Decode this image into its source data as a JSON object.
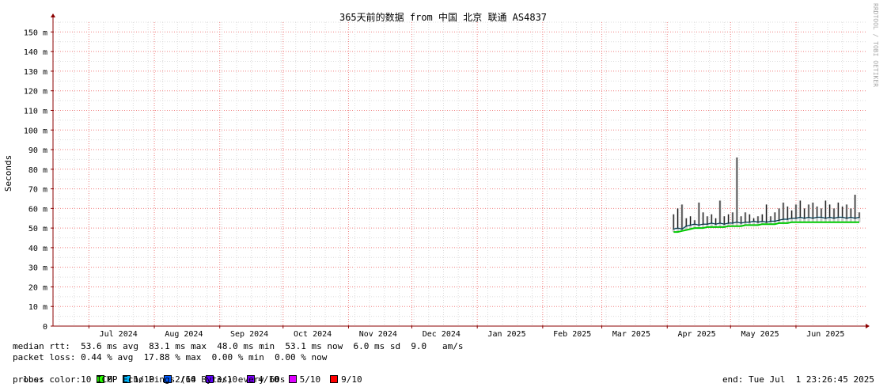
{
  "chart_data": {
    "type": "line",
    "title": "365天前的数据 from 中国 北京 联通 AS4837",
    "xlabel": "",
    "ylabel": "Seconds",
    "ylim": [
      0,
      155
    ],
    "y_ticks": [
      {
        "v": 0,
        "label": "0"
      },
      {
        "v": 10,
        "label": "10 m"
      },
      {
        "v": 20,
        "label": "20 m"
      },
      {
        "v": 30,
        "label": "30 m"
      },
      {
        "v": 40,
        "label": "40 m"
      },
      {
        "v": 50,
        "label": "50 m"
      },
      {
        "v": 60,
        "label": "60 m"
      },
      {
        "v": 70,
        "label": "70 m"
      },
      {
        "v": 80,
        "label": "80 m"
      },
      {
        "v": 90,
        "label": "90 m"
      },
      {
        "v": 100,
        "label": "100 m"
      },
      {
        "v": 110,
        "label": "110 m"
      },
      {
        "v": 120,
        "label": "120 m"
      },
      {
        "v": 130,
        "label": "130 m"
      },
      {
        "v": 140,
        "label": "140 m"
      },
      {
        "v": 150,
        "label": "150 m"
      }
    ],
    "x_range": [
      "2024-06-14",
      "2025-07-04"
    ],
    "x_month_starts": [
      "2024-07-01",
      "2024-08-01",
      "2024-09-01",
      "2024-10-01",
      "2024-11-01",
      "2024-12-01",
      "2025-01-01",
      "2025-02-01",
      "2025-03-01",
      "2025-04-01",
      "2025-05-01",
      "2025-06-01"
    ],
    "x_tick_labels": [
      {
        "date": "2024-07-15",
        "label": "Jul 2024"
      },
      {
        "date": "2024-08-15",
        "label": "Aug 2024"
      },
      {
        "date": "2024-09-15",
        "label": "Sep 2024"
      },
      {
        "date": "2024-10-15",
        "label": "Oct 2024"
      },
      {
        "date": "2024-11-15",
        "label": "Nov 2024"
      },
      {
        "date": "2024-12-15",
        "label": "Dec 2024"
      },
      {
        "date": "2025-01-15",
        "label": "Jan 2025"
      },
      {
        "date": "2025-02-15",
        "label": "Feb 2025"
      },
      {
        "date": "2025-03-15",
        "label": "Mar 2025"
      },
      {
        "date": "2025-04-15",
        "label": "Apr 2025"
      },
      {
        "date": "2025-05-15",
        "label": "May 2025"
      },
      {
        "date": "2025-06-15",
        "label": "Jun 2025"
      }
    ],
    "series": [
      {
        "x": [
          "2025-04-04",
          "2025-04-06",
          "2025-04-08",
          "2025-04-10",
          "2025-04-12",
          "2025-04-14",
          "2025-04-16",
          "2025-04-18",
          "2025-04-20",
          "2025-04-22",
          "2025-04-24",
          "2025-04-26",
          "2025-04-28",
          "2025-04-30",
          "2025-05-02",
          "2025-05-04",
          "2025-05-06",
          "2025-05-08",
          "2025-05-10",
          "2025-05-12",
          "2025-05-14",
          "2025-05-16",
          "2025-05-18",
          "2025-05-20",
          "2025-05-22",
          "2025-05-24",
          "2025-05-26",
          "2025-05-28",
          "2025-05-30",
          "2025-06-01",
          "2025-06-03",
          "2025-06-05",
          "2025-06-07",
          "2025-06-09",
          "2025-06-11",
          "2025-06-13",
          "2025-06-15",
          "2025-06-17",
          "2025-06-19",
          "2025-06-21",
          "2025-06-23",
          "2025-06-25",
          "2025-06-27",
          "2025-06-29",
          "2025-07-01"
        ],
        "median": [
          49.5,
          50.0,
          49.5,
          51.0,
          51.5,
          52.0,
          51.5,
          52.0,
          52.0,
          52.5,
          52.0,
          52.5,
          52.0,
          52.5,
          52.5,
          53.0,
          52.5,
          53.0,
          53.0,
          53.5,
          53.0,
          53.5,
          53.0,
          53.5,
          53.5,
          54.0,
          54.5,
          54.5,
          55.0,
          55.0,
          55.5,
          55.0,
          55.5,
          55.0,
          55.5,
          55.5,
          55.0,
          55.5,
          55.0,
          55.5,
          55.5,
          55.0,
          55.5,
          55.0,
          55.5
        ],
        "max": [
          57,
          60,
          62,
          55,
          56,
          54,
          63,
          58,
          56,
          57,
          55,
          64,
          56,
          57,
          58,
          86,
          56,
          58,
          57,
          55,
          56,
          57,
          62,
          56,
          58,
          60,
          63,
          61,
          59,
          62,
          64,
          60,
          62,
          63,
          61,
          60,
          64,
          62,
          60,
          63,
          61,
          62,
          60,
          67,
          58
        ],
        "min": [
          48.0,
          48.0,
          48.5,
          49.0,
          49.5,
          50.0,
          50.0,
          50.0,
          50.5,
          50.5,
          50.5,
          50.5,
          50.5,
          51.0,
          51.0,
          51.0,
          51.0,
          51.5,
          51.5,
          51.5,
          51.5,
          52.0,
          52.0,
          52.0,
          52.0,
          52.5,
          52.5,
          52.5,
          53.0,
          53.0,
          53.0,
          53.0,
          53.0,
          53.0,
          53.0,
          53.0,
          53.0,
          53.0,
          53.0,
          53.0,
          53.0,
          53.0,
          53.0,
          53.0,
          53.0
        ]
      }
    ],
    "grid": true,
    "colors": {
      "minor_grid": "#dcdcdc",
      "major_grid": "#f08080",
      "axis": "#8b0000",
      "smoke": "#cccccc",
      "median_line": "#1a1a1a",
      "loss_band": "#00c800"
    }
  },
  "stats": {
    "median_rtt": "median rtt:  53.6 ms avg  83.1 ms max  48.0 ms min  53.1 ms now  6.0 ms sd  9.0   am/s",
    "packet_loss": "packet loss: 0.44 % avg  17.88 % max  0.00 % min  0.00 % now",
    "loss_color_label": "loss color:",
    "loss_colors": [
      {
        "label": "0",
        "color": "#26ff00"
      },
      {
        "label": "1/10",
        "color": "#00b8ff"
      },
      {
        "label": "2/10",
        "color": "#0059ff"
      },
      {
        "label": "3/10",
        "color": "#5e00ff"
      },
      {
        "label": "4/10",
        "color": "#7e00ff"
      },
      {
        "label": "5/10",
        "color": "#dd00ff"
      },
      {
        "label": "9/10",
        "color": "#ff0000"
      }
    ],
    "probe": "probe:       10 ICMP Echo Pings (64 Bytes) every 60s",
    "end": "end: Tue Jul  1 23:26:45 2025"
  },
  "credit": "RRDTOOL / TOBI OETIKER"
}
